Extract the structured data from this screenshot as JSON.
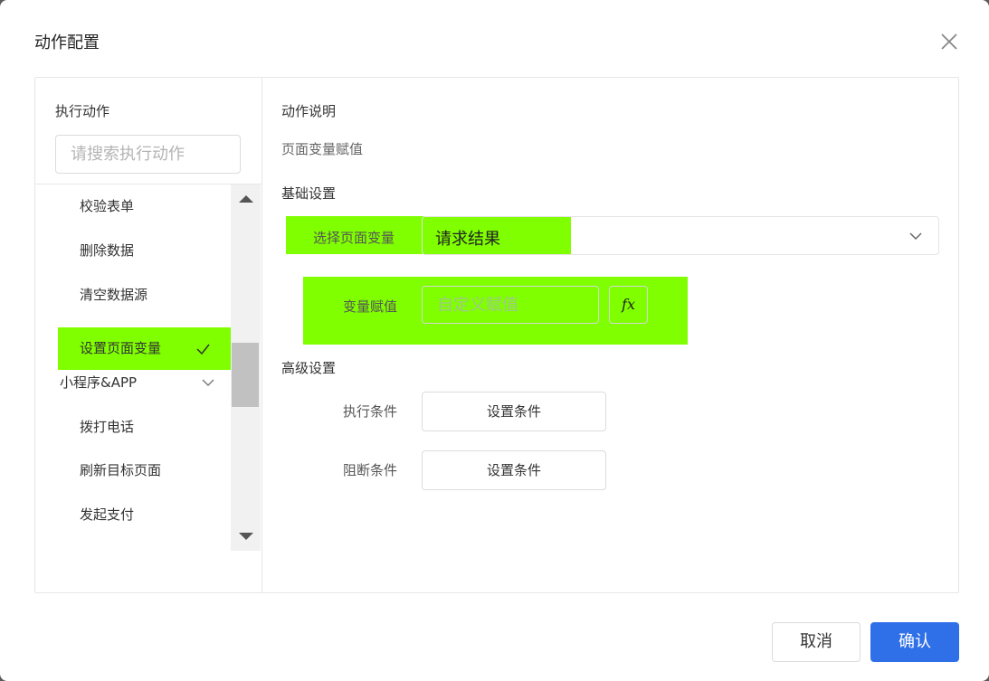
{
  "dialog": {
    "title": "动作配置",
    "close_icon": "close-icon"
  },
  "left_panel": {
    "title": "执行动作",
    "search_placeholder": "请搜索执行动作",
    "items": [
      {
        "label": "校验表单",
        "type": "action"
      },
      {
        "label": "删除数据",
        "type": "action"
      },
      {
        "label": "清空数据源",
        "type": "action"
      },
      {
        "label": "设置页面变量",
        "type": "action",
        "selected": true
      },
      {
        "label": "小程序&APP",
        "type": "group"
      },
      {
        "label": "拨打电话",
        "type": "action"
      },
      {
        "label": "刷新目标页面",
        "type": "action"
      },
      {
        "label": "发起支付",
        "type": "action"
      }
    ]
  },
  "right_panel": {
    "desc_title": "动作说明",
    "desc_text": "页面变量赋值",
    "basic_title": "基础设置",
    "select_var_label": "选择页面变量",
    "select_var_value": "请求结果",
    "assign_label": "变量赋值",
    "assign_placeholder": "自定义赋值",
    "fx_label": "fx",
    "advanced_title": "高级设置",
    "exec_cond_label": "执行条件",
    "exec_cond_button": "设置条件",
    "block_cond_label": "阻断条件",
    "block_cond_button": "设置条件"
  },
  "footer": {
    "cancel": "取消",
    "confirm": "确认"
  },
  "colors": {
    "highlight": "#7fff00",
    "primary": "#2f6fe8"
  }
}
